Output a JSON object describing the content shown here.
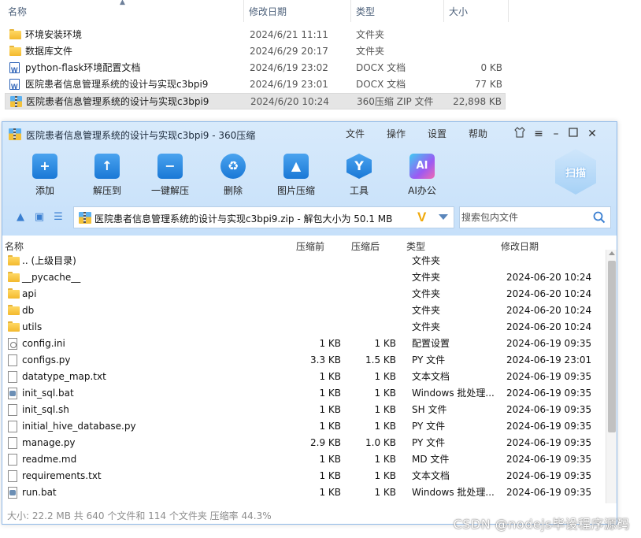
{
  "explorer": {
    "columns": {
      "name": "名称",
      "date": "修改日期",
      "type": "类型",
      "size": "大小"
    },
    "rows": [
      {
        "icon": "folder-icon",
        "name": "环境安装环境",
        "date": "2024/6/21 11:11",
        "type": "文件夹",
        "size": ""
      },
      {
        "icon": "folder-icon",
        "name": "数据库文件",
        "date": "2024/6/29 20:17",
        "type": "文件夹",
        "size": ""
      },
      {
        "icon": "word-doc-icon",
        "name": "python-flask环境配置文档",
        "date": "2024/6/19 23:02",
        "type": "DOCX 文档",
        "size": "0 KB"
      },
      {
        "icon": "word-doc-icon",
        "name": "医院患者信息管理系统的设计与实现c3bpi9",
        "date": "2024/6/19 23:01",
        "type": "DOCX 文档",
        "size": "77 KB"
      },
      {
        "icon": "zip-icon",
        "name": "医院患者信息管理系统的设计与实现c3bpi9",
        "date": "2024/6/20 10:24",
        "type": "360压缩 ZIP 文件",
        "size": "22,898 KB"
      }
    ]
  },
  "app": {
    "title": "医院患者信息管理系统的设计与实现c3bpi9 - 360压缩",
    "menu": [
      "文件",
      "操作",
      "设置",
      "帮助"
    ],
    "toolbar": {
      "add": "添加",
      "extract_to": "解压到",
      "one_click_extract": "一键解压",
      "delete": "删除",
      "image_compress": "图片压缩",
      "tools": "工具",
      "ai_office": "AI办公",
      "scan": "扫描"
    },
    "path": "医院患者信息管理系统的设计与实现c3bpi9.zip - 解包大小为 50.1 MB",
    "search_placeholder": "搜索包内文件",
    "columns": {
      "name": "名称",
      "compressed": "压缩前",
      "uncompressed": "压缩后",
      "type": "类型",
      "date": "修改日期"
    },
    "rows": [
      {
        "icon": "folder-icon",
        "name": ".. (上级目录)",
        "compressed": "",
        "uncompressed": "",
        "type": "文件夹",
        "date": ""
      },
      {
        "icon": "folder-icon",
        "name": "__pycache__",
        "compressed": "",
        "uncompressed": "",
        "type": "文件夹",
        "date": "2024-06-20 10:24"
      },
      {
        "icon": "folder-icon",
        "name": "api",
        "compressed": "",
        "uncompressed": "",
        "type": "文件夹",
        "date": "2024-06-20 10:24"
      },
      {
        "icon": "folder-icon",
        "name": "db",
        "compressed": "",
        "uncompressed": "",
        "type": "文件夹",
        "date": "2024-06-20 10:24"
      },
      {
        "icon": "folder-icon",
        "name": "utils",
        "compressed": "",
        "uncompressed": "",
        "type": "文件夹",
        "date": "2024-06-20 10:24"
      },
      {
        "icon": "config-file-icon",
        "name": "config.ini",
        "compressed": "1 KB",
        "uncompressed": "1 KB",
        "type": "配置设置",
        "date": "2024-06-19 09:35"
      },
      {
        "icon": "file-icon",
        "name": "configs.py",
        "compressed": "3.3 KB",
        "uncompressed": "1.5 KB",
        "type": "PY 文件",
        "date": "2024-06-19 23:01"
      },
      {
        "icon": "file-icon",
        "name": "datatype_map.txt",
        "compressed": "1 KB",
        "uncompressed": "1 KB",
        "type": "文本文档",
        "date": "2024-06-19 09:35"
      },
      {
        "icon": "bat-file-icon",
        "name": "init_sql.bat",
        "compressed": "1 KB",
        "uncompressed": "1 KB",
        "type": "Windows 批处理...",
        "date": "2024-06-19 09:35"
      },
      {
        "icon": "file-icon",
        "name": "init_sql.sh",
        "compressed": "1 KB",
        "uncompressed": "1 KB",
        "type": "SH 文件",
        "date": "2024-06-19 09:35"
      },
      {
        "icon": "file-icon",
        "name": "initial_hive_database.py",
        "compressed": "1 KB",
        "uncompressed": "1 KB",
        "type": "PY 文件",
        "date": "2024-06-19 09:35"
      },
      {
        "icon": "file-icon",
        "name": "manage.py",
        "compressed": "2.9 KB",
        "uncompressed": "1.0 KB",
        "type": "PY 文件",
        "date": "2024-06-19 09:35"
      },
      {
        "icon": "file-icon",
        "name": "readme.md",
        "compressed": "1 KB",
        "uncompressed": "1 KB",
        "type": "MD 文件",
        "date": "2024-06-19 09:35"
      },
      {
        "icon": "file-icon",
        "name": "requirements.txt",
        "compressed": "1 KB",
        "uncompressed": "1 KB",
        "type": "文本文档",
        "date": "2024-06-19 09:35"
      },
      {
        "icon": "bat-file-icon",
        "name": "run.bat",
        "compressed": "1 KB",
        "uncompressed": "1 KB",
        "type": "Windows 批处理...",
        "date": "2024-06-19 09:35"
      }
    ],
    "status": "大小: 22.2 MB 共 640 个文件和 114 个文件夹 压缩率 44.3%"
  },
  "watermark": "CSDN @nodejs毕设程序源码"
}
